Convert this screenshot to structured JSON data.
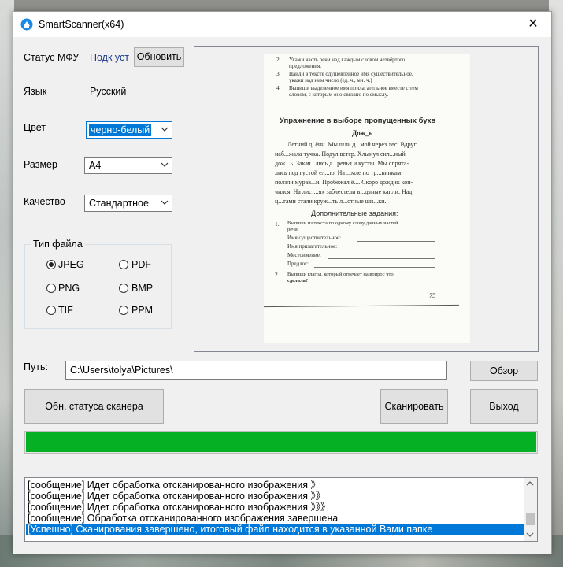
{
  "window": {
    "title": "SmartScanner(x64)"
  },
  "left_panel": {
    "mfu_status_label": "Статус МФУ",
    "mfu_status_value": "Подк уст",
    "refresh_button": "Обновить",
    "language_label": "Язык",
    "language_value": "Русский",
    "color_label": "Цвет",
    "color_value": "черно-белый",
    "size_label": "Размер",
    "size_value": "А4",
    "quality_label": "Качество",
    "quality_value": "Стандартное"
  },
  "file_type": {
    "legend": "Тип файла",
    "options": [
      "JPEG",
      "PDF",
      "PNG",
      "BMP",
      "TIF",
      "PPM"
    ],
    "selected": "JPEG"
  },
  "preview_page": {
    "tasks_top": [
      {
        "num": "2.",
        "lines": [
          "Укажи часть речи над каждым словом четвёртого",
          "предложения."
        ]
      },
      {
        "num": "3.",
        "lines": [
          "Найди в тексте одушевлённое имя существительное,",
          "укажи над ним число (ед. ч., мн. ч.)"
        ]
      },
      {
        "num": "4.",
        "lines": [
          "Выпиши выделенное имя прилагательное вместе с тем",
          "словом, с которым оно связано по смыслу."
        ]
      }
    ],
    "exercise_title": "Упражнение в выборе пропущенных букв",
    "story_title": "Дож_ь",
    "story_lines": [
      "Летний д..ённ. Мы шли д...мой через лес. Вдруг",
      "наб...жала тучка. Подул ветер. Хлынул сил...ный",
      "дож...ь. Закач...лись д...ревья и кусты. Мы спрята-",
      "лись под густой ел...ю. На ...мле по тр...винкам",
      "ползли мурав...и. Пробежал ё.... Скоро дождик кон-",
      "чился. На лист...ях заблестели в...дяные капли. Над",
      "ц...тами стали круж...ть л...отные ши...ки."
    ],
    "extra_title": "Дополнительные задания:",
    "extra_task1_num": "1.",
    "extra_task1_lines": [
      "Выпиши из текста по одному слову данных частей",
      "речи:"
    ],
    "extra_fields": [
      "Имя существительное:",
      "Имя прилагательное:",
      "Местоимение:",
      "Предлог:"
    ],
    "extra_task2_num": "2.",
    "extra_task2_lines": [
      "Выпиши глагол, который отвечает на вопрос что",
      "сделала?"
    ],
    "page_number": "75"
  },
  "path": {
    "label": "Путь:",
    "value": "C:\\Users\\tolya\\Pictures\\",
    "browse_button": "Обзор"
  },
  "actions": {
    "scanner_status_button": "Обн. статуса сканера",
    "scan_button": "Сканировать",
    "exit_button": "Выход"
  },
  "progress": {
    "fraction": 1.0,
    "color": "#06b025"
  },
  "log": {
    "lines": [
      "[сообщение] Идет обработка отсканированного изображения 》",
      "[сообщение] Идет обработка отсканированного изображения 》》",
      "[сообщение] Идет обработка отсканированного изображения 》》》",
      "[сообщение] Обработка отсканированного изображения завершена",
      "[Успешно] Сканирования завершено, итоговый файл находится в указанной Вами папке"
    ],
    "selected_index": 4
  },
  "colors": {
    "accent": "#0078d7",
    "progress": "#06b025",
    "link_blue": "#1a3a8a"
  }
}
